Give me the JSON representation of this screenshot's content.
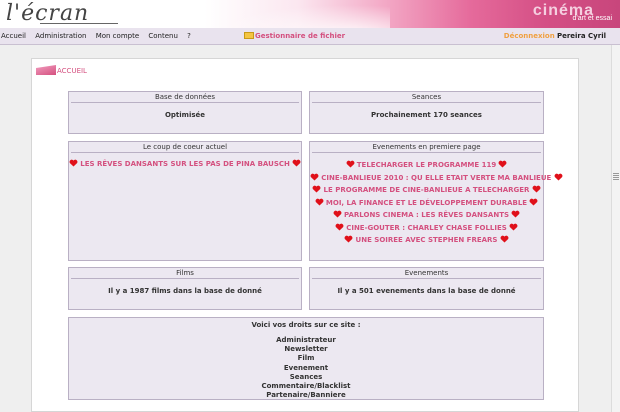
{
  "header": {
    "logo_text": "l'écran",
    "brand_cinema": "cinéma",
    "brand_sub": "d'art et essai"
  },
  "menu": {
    "items": [
      "Accueil",
      "Administration",
      "Mon compte",
      "Contenu",
      "?"
    ],
    "file_manager": "Gestionnaire de fichier",
    "logout": "Déconnexion",
    "user_name": "Pereira Cyril"
  },
  "breadcrumb": "ACCUEIL",
  "boxes": {
    "database": {
      "title": "Base de données",
      "text": "Optimisée"
    },
    "sessions": {
      "title": "Seances",
      "text": "Prochainement 170 seances"
    },
    "favorite": {
      "title": "Le coup de coeur actuel",
      "item": "LES RÊVES DANSANTS SUR LES PAS DE PINA BAUSCH"
    },
    "events_home": {
      "title": "Evenements en premiere page",
      "items": [
        "TELECHARGER LE PROGRAMME 119",
        "CINE-BANLIEUE 2010 : QU ELLE ETAIT VERTE MA BANLIEUE",
        "LE PROGRAMME DE CINE-BANLIEUE A TELECHARGER",
        "MOI, LA FINANCE ET LE DÉVELOPPEMENT DURABLE",
        "PARLONS CINEMA : LES RÊVES DANSANTS",
        "CINE-GOUTER : CHARLEY CHASE FOLLIES",
        "UNE SOIREE AVEC STEPHEN FREARS"
      ]
    },
    "films": {
      "title": "Films",
      "text": "Il y a 1987 films dans la base de donné"
    },
    "events": {
      "title": "Evenements",
      "text": "Il y a 501 evenements dans la base de donné"
    },
    "rights": {
      "title": "Voici vos droits sur ce site :",
      "items": [
        "Administrateur",
        "Newsletter",
        "Film",
        "Evenement",
        "Seances",
        "Commentaire/Blacklist",
        "Partenaire/Banniere"
      ]
    }
  },
  "colors": {
    "accent": "#d4507f",
    "heart": "#e0101a",
    "box_bg": "#ece8f1",
    "logout": "#f0a040"
  },
  "icons": {
    "heart": "heart-icon",
    "folder": "folder-icon"
  }
}
